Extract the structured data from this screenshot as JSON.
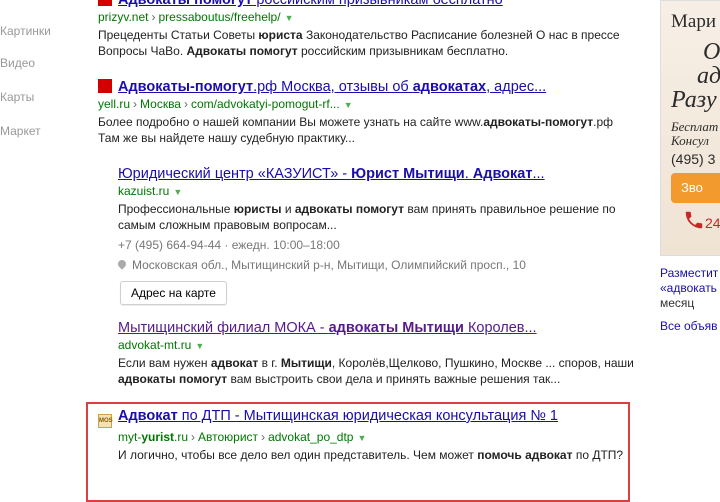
{
  "nav": {
    "items": [
      "Картинки",
      "Видео",
      "Карты",
      "Маркет"
    ]
  },
  "results": [
    {
      "title_parts": [
        {
          "t": "Адвокаты помогут",
          "b": true
        },
        {
          "t": " российским призывникам бесплатно",
          "b": false
        }
      ],
      "favicon": "red-square-icon",
      "url_host": "prizyv.net",
      "url_path": "pressaboutus/freehelp/",
      "snippet_parts": [
        {
          "t": "Прецеденты Статьи Советы ",
          "b": false
        },
        {
          "t": "юриста",
          "b": true
        },
        {
          "t": " Законодательство Расписание болезней О нас в прессе Вопросы ЧаВо. ",
          "b": false
        },
        {
          "t": "Адвокаты помогут",
          "b": true
        },
        {
          "t": " российским призывникам бесплатно.",
          "b": false
        }
      ]
    },
    {
      "title_parts": [
        {
          "t": "Адвокаты-помогут",
          "b": true
        },
        {
          "t": ".рф Москва, отзывы об ",
          "b": false
        },
        {
          "t": "адвокатах",
          "b": true
        },
        {
          "t": ", адрес...",
          "b": false
        }
      ],
      "favicon": "red-square-icon",
      "url_host": "yell.ru",
      "url_crumbs": [
        "Москва",
        "com/advokatyi-pomogut-rf..."
      ],
      "snippet_parts": [
        {
          "t": "Более подробно о нашей компании Вы можете узнать на сайте www.",
          "b": false
        },
        {
          "t": "адвокаты-помогут",
          "b": true
        },
        {
          "t": ".рф Там же вы найдете нашу судебную практику...",
          "b": false
        }
      ]
    },
    {
      "title_parts": [
        {
          "t": "Юридический центр «КАЗУИСТ» - ",
          "b": false
        },
        {
          "t": "Юрист Мытищи",
          "b": true
        },
        {
          "t": ". ",
          "b": false
        },
        {
          "t": "Адвокат",
          "b": true
        },
        {
          "t": "...",
          "b": false
        }
      ],
      "url_host": "kazuist.ru",
      "snippet_parts": [
        {
          "t": "Профессиональные ",
          "b": false
        },
        {
          "t": "юристы",
          "b": true
        },
        {
          "t": " и ",
          "b": false
        },
        {
          "t": "адвокаты помогут",
          "b": true
        },
        {
          "t": " вам принять правильное решение по самым сложным правовым вопросам...",
          "b": false
        }
      ],
      "phone_hours": "+7 (495) 664-94-44 · ежедн. 10:00–18:00",
      "address": "Московская обл., Мытищинский р-н, Мытищи, Олимпийский просп., 10",
      "map_button": "Адрес на карте"
    },
    {
      "title_parts": [
        {
          "t": "Мытищинский филиал МОКА - ",
          "b": false
        },
        {
          "t": "адвокаты Мытищи",
          "b": true
        },
        {
          "t": " Королев...",
          "b": false
        }
      ],
      "url_host": "advokat-mt.ru",
      "snippet_parts": [
        {
          "t": "Если вам нужен ",
          "b": false
        },
        {
          "t": "адвокат",
          "b": true
        },
        {
          "t": " в г. ",
          "b": false
        },
        {
          "t": "Мытищи",
          "b": true
        },
        {
          "t": ", Королёв,Щелково, Пушкино, Москве ... споров, наши ",
          "b": false
        },
        {
          "t": "адвокаты помогут",
          "b": true
        },
        {
          "t": " вам выстроить свои дела и принять важные решения так...",
          "b": false
        }
      ]
    },
    {
      "title_parts": [
        {
          "t": "Адвокат",
          "b": true
        },
        {
          "t": " по ДТП - Мытищинская юридическая консультация № 1",
          "b": false
        }
      ],
      "favicon": "mos-badge-icon",
      "url_host_parts": [
        {
          "t": "myt-",
          "b": false
        },
        {
          "t": "yurist",
          "b": true
        },
        {
          "t": ".ru",
          "b": false
        }
      ],
      "url_crumbs": [
        "Автоюрист",
        "advokat_po_dtp"
      ],
      "snippet_parts": [
        {
          "t": "И логично, чтобы все дело вел один представитель. Чем может ",
          "b": false
        },
        {
          "t": "помочь адвокат",
          "b": true
        },
        {
          "t": " по ДТП?",
          "b": false
        }
      ]
    }
  ],
  "ad": {
    "lines": [
      "Мари",
      "О",
      "адв",
      "Разу",
      "Бесплат",
      "Консул",
      "(495) 3"
    ],
    "call_label": "Зво",
    "phone_fragment": "24"
  },
  "sidebar": {
    "place_link": "Разместит",
    "query_text": "«адвокать",
    "month": "месяц",
    "all_ads": "Все объяв"
  },
  "colors": {
    "title": "#1a0dab",
    "visited": "#551a8b",
    "url": "#007700",
    "highlight": "#d94040",
    "call": "#f29a2e"
  }
}
